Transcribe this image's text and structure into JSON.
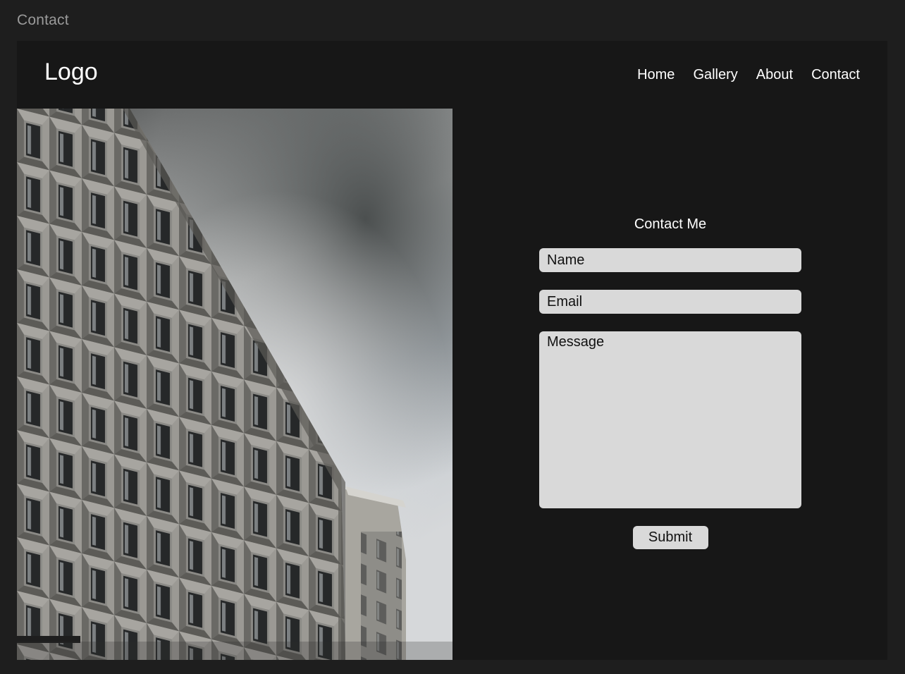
{
  "frame": {
    "label": "Contact"
  },
  "header": {
    "logo": "Logo",
    "nav": [
      {
        "label": "Home"
      },
      {
        "label": "Gallery"
      },
      {
        "label": "About"
      },
      {
        "label": "Contact"
      }
    ]
  },
  "contact_form": {
    "title": "Contact Me",
    "name_placeholder": "Name",
    "email_placeholder": "Email",
    "message_placeholder": "Message",
    "submit_label": "Submit"
  },
  "colors": {
    "page_background": "#1e1e1e",
    "frame_background": "#171717",
    "field_background": "#d9d9d9",
    "text_light": "#ffffff",
    "text_dark": "#111111"
  }
}
